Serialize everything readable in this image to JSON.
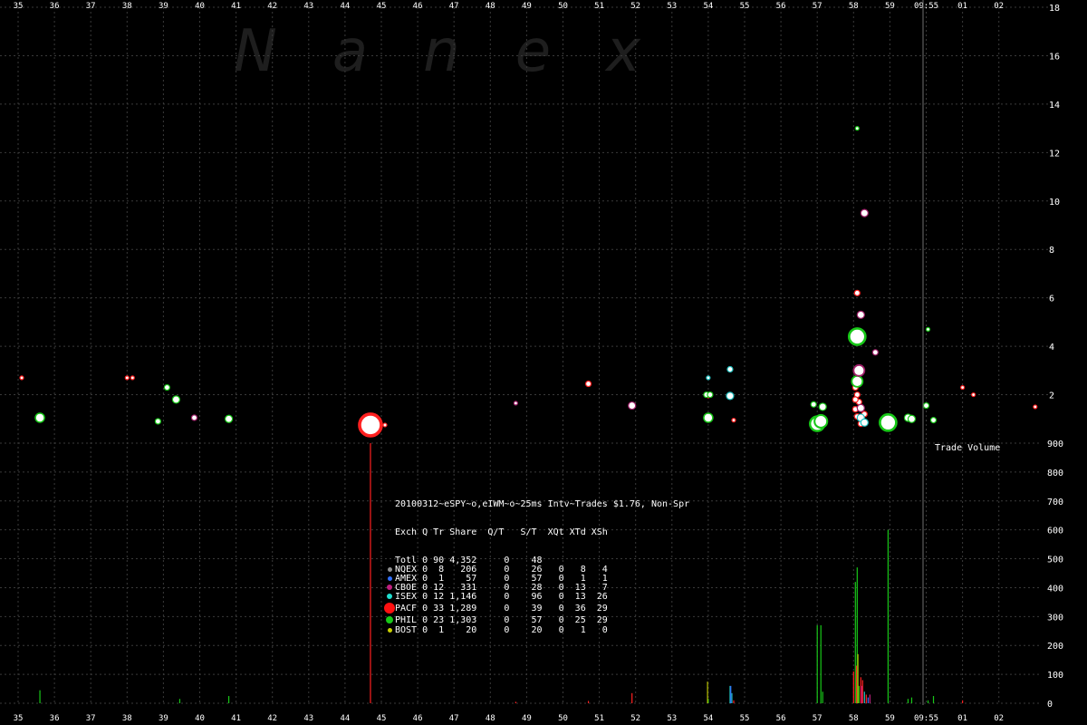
{
  "watermark": "N   a   n   e   x",
  "volume_panel_label": "Trade Volume",
  "chart_data": [
    {
      "type": "scatter",
      "title": "",
      "x_tick_labels": [
        "35",
        "36",
        "37",
        "38",
        "39",
        "40",
        "41",
        "42",
        "43",
        "44",
        "45",
        "46",
        "47",
        "48",
        "49",
        "50",
        "51",
        "52",
        "53",
        "54",
        "55",
        "56",
        "57",
        "58",
        "59",
        "09:55",
        "01",
        "02"
      ],
      "x_tick_values": [
        35,
        36,
        37,
        38,
        39,
        40,
        41,
        42,
        43,
        44,
        45,
        46,
        47,
        48,
        49,
        50,
        51,
        52,
        53,
        54,
        55,
        56,
        57,
        58,
        59,
        60,
        61,
        62
      ],
      "xlim": [
        34.6,
        63
      ],
      "y_ticks": [
        2,
        4,
        6,
        8,
        10,
        12,
        14,
        16,
        18
      ],
      "ylim": [
        0,
        18
      ],
      "grid": true,
      "note_time_marker_x": 60,
      "series": [
        {
          "name": "PACF",
          "color": "#ff2020",
          "points": [
            {
              "x": 35.1,
              "y": 2.7,
              "s": 2
            },
            {
              "x": 38.0,
              "y": 2.7,
              "s": 2
            },
            {
              "x": 38.15,
              "y": 2.7,
              "s": 2
            },
            {
              "x": 44.7,
              "y": 0.75,
              "s": 12
            },
            {
              "x": 45.1,
              "y": 0.75,
              "s": 2
            },
            {
              "x": 50.7,
              "y": 2.45,
              "s": 3
            },
            {
              "x": 54.0,
              "y": 1.95,
              "s": 2
            },
            {
              "x": 54.7,
              "y": 0.95,
              "s": 2
            },
            {
              "x": 58.1,
              "y": 6.2,
              "s": 3
            },
            {
              "x": 58.05,
              "y": 2.3,
              "s": 3
            },
            {
              "x": 58.1,
              "y": 2.0,
              "s": 3
            },
            {
              "x": 58.15,
              "y": 1.7,
              "s": 3
            },
            {
              "x": 58.05,
              "y": 1.4,
              "s": 3
            },
            {
              "x": 58.1,
              "y": 1.1,
              "s": 3
            },
            {
              "x": 58.2,
              "y": 0.8,
              "s": 3
            },
            {
              "x": 58.3,
              "y": 1.2,
              "s": 3
            },
            {
              "x": 58.05,
              "y": 1.8,
              "s": 3
            },
            {
              "x": 61.0,
              "y": 2.3,
              "s": 2
            },
            {
              "x": 61.3,
              "y": 2.0,
              "s": 2
            },
            {
              "x": 63.0,
              "y": 1.5,
              "s": 2
            }
          ]
        },
        {
          "name": "PHIL",
          "color": "#18c818",
          "points": [
            {
              "x": 35.6,
              "y": 1.05,
              "s": 5
            },
            {
              "x": 39.1,
              "y": 2.3,
              "s": 3
            },
            {
              "x": 39.35,
              "y": 1.8,
              "s": 4
            },
            {
              "x": 38.85,
              "y": 0.9,
              "s": 3
            },
            {
              "x": 40.8,
              "y": 1.0,
              "s": 4
            },
            {
              "x": 54.0,
              "y": 1.05,
              "s": 5
            },
            {
              "x": 57.0,
              "y": 0.8,
              "s": 8
            },
            {
              "x": 57.1,
              "y": 0.9,
              "s": 7
            },
            {
              "x": 56.9,
              "y": 1.6,
              "s": 3
            },
            {
              "x": 57.15,
              "y": 1.5,
              "s": 4
            },
            {
              "x": 58.1,
              "y": 4.4,
              "s": 9
            },
            {
              "x": 58.1,
              "y": 2.55,
              "s": 6
            },
            {
              "x": 58.1,
              "y": 13.0,
              "s": 2
            },
            {
              "x": 58.95,
              "y": 0.85,
              "s": 9
            },
            {
              "x": 59.5,
              "y": 1.05,
              "s": 4
            },
            {
              "x": 59.6,
              "y": 1.0,
              "s": 4
            },
            {
              "x": 60.05,
              "y": 4.7,
              "s": 2
            },
            {
              "x": 60.0,
              "y": 1.55,
              "s": 3
            },
            {
              "x": 60.2,
              "y": 0.95,
              "s": 3
            },
            {
              "x": 53.95,
              "y": 2.0,
              "s": 3
            },
            {
              "x": 54.05,
              "y": 2.0,
              "s": 3
            }
          ]
        },
        {
          "name": "ISEX",
          "color": "#20c0c0",
          "points": [
            {
              "x": 54.0,
              "y": 2.7,
              "s": 2
            },
            {
              "x": 54.6,
              "y": 3.05,
              "s": 3
            },
            {
              "x": 54.6,
              "y": 1.95,
              "s": 4
            },
            {
              "x": 58.2,
              "y": 1.05,
              "s": 4
            },
            {
              "x": 58.3,
              "y": 0.85,
              "s": 4
            }
          ]
        },
        {
          "name": "CBOE",
          "color": "#a0206a",
          "points": [
            {
              "x": 39.85,
              "y": 1.05,
              "s": 3
            },
            {
              "x": 48.7,
              "y": 1.65,
              "s": 2
            },
            {
              "x": 51.9,
              "y": 1.55,
              "s": 4
            },
            {
              "x": 58.3,
              "y": 9.5,
              "s": 4
            },
            {
              "x": 58.2,
              "y": 5.3,
              "s": 4
            },
            {
              "x": 58.15,
              "y": 3.0,
              "s": 6
            },
            {
              "x": 58.6,
              "y": 3.75,
              "s": 3
            },
            {
              "x": 58.2,
              "y": 1.45,
              "s": 4
            }
          ]
        }
      ]
    },
    {
      "type": "bar",
      "title": "",
      "y_ticks": [
        0,
        100,
        200,
        300,
        400,
        500,
        600,
        700,
        800,
        900
      ],
      "ylim": [
        0,
        900
      ],
      "series": [
        {
          "name": "PHIL",
          "color": "#18c818",
          "bars": [
            {
              "x": 35.6,
              "v": 45
            },
            {
              "x": 39.45,
              "v": 15
            },
            {
              "x": 40.8,
              "v": 25
            },
            {
              "x": 54.0,
              "v": 15
            },
            {
              "x": 57.0,
              "v": 270
            },
            {
              "x": 57.1,
              "v": 270
            },
            {
              "x": 57.15,
              "v": 40
            },
            {
              "x": 58.05,
              "v": 420
            },
            {
              "x": 58.1,
              "v": 470
            },
            {
              "x": 58.15,
              "v": 60
            },
            {
              "x": 58.95,
              "v": 600
            },
            {
              "x": 59.5,
              "v": 15
            },
            {
              "x": 59.6,
              "v": 20
            },
            {
              "x": 60.05,
              "v": 10
            },
            {
              "x": 60.2,
              "v": 25
            }
          ]
        },
        {
          "name": "PACF",
          "color": "#ff2020",
          "bars": [
            {
              "x": 44.7,
              "v": 900
            },
            {
              "x": 48.7,
              "v": 5
            },
            {
              "x": 50.7,
              "v": 8
            },
            {
              "x": 51.9,
              "v": 35
            },
            {
              "x": 54.7,
              "v": 10
            },
            {
              "x": 58.0,
              "v": 110
            },
            {
              "x": 58.08,
              "v": 130
            },
            {
              "x": 58.2,
              "v": 90
            },
            {
              "x": 58.25,
              "v": 80
            },
            {
              "x": 58.35,
              "v": 30
            },
            {
              "x": 61.0,
              "v": 10
            }
          ]
        },
        {
          "name": "ISEX",
          "color": "#20c0c0",
          "bars": [
            {
              "x": 54.6,
              "v": 60
            },
            {
              "x": 54.65,
              "v": 35
            },
            {
              "x": 58.3,
              "v": 40
            }
          ]
        },
        {
          "name": "AMEX",
          "color": "#3070ff",
          "bars": [
            {
              "x": 54.62,
              "v": 60
            },
            {
              "x": 58.4,
              "v": 20
            }
          ]
        },
        {
          "name": "BOST",
          "color": "#b8c000",
          "bars": [
            {
              "x": 53.98,
              "v": 75
            },
            {
              "x": 58.12,
              "v": 170
            }
          ]
        },
        {
          "name": "CBOE",
          "color": "#c02080",
          "bars": [
            {
              "x": 58.22,
              "v": 60
            },
            {
              "x": 58.45,
              "v": 30
            }
          ]
        }
      ]
    }
  ],
  "legend": {
    "title": "20100312~eSPY~o,eIWM~o~25ms Intv~Trades $1.76, Non-Spr",
    "header": "Exch Q Tr Share  Q/T   S/T  XQt XTd XSh",
    "rows": [
      {
        "text": "Totl 0 90 4,352     0    48",
        "color": "",
        "dot": 0
      },
      {
        "text": "NQEX 0  8   206     0    26   0   8   4",
        "color": "#909090",
        "dot": 5
      },
      {
        "text": "AMEX 0  1    57     0    57   0   1   1",
        "color": "#3070ff",
        "dot": 5
      },
      {
        "text": "CBOE 0 12   331     0    28   0  13   7",
        "color": "#c02080",
        "dot": 6
      },
      {
        "text": "ISEX 0 12 1,146     0    96   0  13  26",
        "color": "#20e0d0",
        "dot": 6
      },
      {
        "text": "PACF 0 33 1,289     0    39   0  36  29",
        "color": "#ff1010",
        "dot": 12
      },
      {
        "text": "PHIL 0 23 1,303     0    57   0  25  29",
        "color": "#18c818",
        "dot": 8
      },
      {
        "text": "BOST 0  1    20     0    20   0   1   0",
        "color": "#c8d000",
        "dot": 5
      }
    ]
  }
}
